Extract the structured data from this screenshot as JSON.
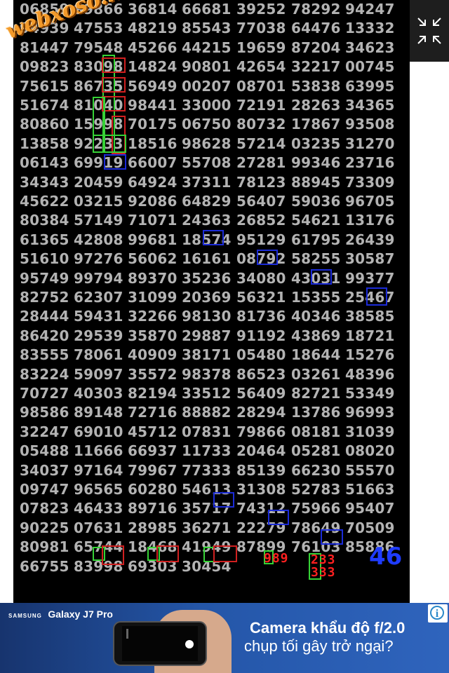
{
  "watermark": "webxoso.net",
  "rows": [
    [
      "06859",
      "99866",
      "36814",
      "66681",
      "39252",
      "78292",
      "94247"
    ],
    [
      "94939",
      "47553",
      "48219",
      "85543",
      "77038",
      "64476",
      "13332"
    ],
    [
      "81447",
      "79548",
      "45266",
      "44215",
      "19659",
      "87204",
      "34623"
    ],
    [
      "09823",
      "83098",
      "14824",
      "90801",
      "42654",
      "32217",
      "00745"
    ],
    [
      "75615",
      "86735",
      "56949",
      "00207",
      "08701",
      "53838",
      "63995"
    ],
    [
      "51674",
      "81040",
      "98441",
      "33000",
      "72191",
      "28263",
      "34365"
    ],
    [
      "80860",
      "15998",
      "70175",
      "06750",
      "80732",
      "17867",
      "93508"
    ],
    [
      "13858",
      "92233",
      "18516",
      "98628",
      "57214",
      "03235",
      "31270"
    ],
    [
      "06143",
      "69919",
      "66007",
      "55708",
      "27281",
      "99346",
      "23716"
    ],
    [
      "34343",
      "20459",
      "64924",
      "37311",
      "78123",
      "88945",
      "73309"
    ],
    [
      "45622",
      "03215",
      "92086",
      "64829",
      "56407",
      "59036",
      "96705"
    ],
    [
      "80384",
      "57149",
      "71071",
      "24363",
      "26852",
      "54621",
      "13176"
    ],
    [
      "61365",
      "42808",
      "99681",
      "18574",
      "95129",
      "61795",
      "26439"
    ],
    [
      "51610",
      "97276",
      "56062",
      "16161",
      "08792",
      "58255",
      "30587"
    ],
    [
      "95749",
      "99794",
      "89370",
      "35236",
      "34080",
      "43031",
      "99377"
    ],
    [
      "82752",
      "62307",
      "31099",
      "20369",
      "56321",
      "15355",
      "25467"
    ],
    [
      "28444",
      "59431",
      "32266",
      "98130",
      "81736",
      "40346",
      "38585"
    ],
    [
      "86420",
      "29539",
      "35870",
      "29887",
      "91192",
      "43869",
      "18721"
    ],
    [
      "83555",
      "78061",
      "40909",
      "38171",
      "05480",
      "18644",
      "15276"
    ],
    [
      "83224",
      "59097",
      "35572",
      "98378",
      "86523",
      "03261",
      "48396"
    ],
    [
      "70727",
      "40303",
      "82194",
      "33512",
      "56409",
      "82721",
      "53349"
    ],
    [
      "98586",
      "89148",
      "72716",
      "88882",
      "28294",
      "13786",
      "96993"
    ],
    [
      "32247",
      "69010",
      "45712",
      "07831",
      "79866",
      "08181",
      "31039"
    ],
    [
      "05488",
      "11666",
      "66937",
      "11733",
      "20464",
      "05281",
      "08020"
    ],
    [
      "34037",
      "97164",
      "79967",
      "77333",
      "85139",
      "66230",
      "55570"
    ],
    [
      "09747",
      "96565",
      "60280",
      "54613",
      "31308",
      "52783",
      "51663"
    ],
    [
      "07823",
      "46433",
      "89716",
      "35717",
      "74312",
      "75966",
      "95407"
    ],
    [
      "90225",
      "07631",
      "28985",
      "36271",
      "22279",
      "78649",
      "70509"
    ],
    [
      "80981",
      "65744",
      "18468",
      "41949",
      "87899",
      "76103",
      "85886"
    ],
    [
      "66755",
      "83998",
      "69303",
      "30454"
    ]
  ],
  "annotations": {
    "red_line1": "989",
    "red_line2a": "233",
    "red_line2b": "333",
    "big_number": "46"
  },
  "ad": {
    "brand": "SAMSUNG",
    "model": "Galaxy J7 Pro",
    "headline": "Camera khẩu độ f/2.0",
    "subline": "chụp tối gây trở ngại?",
    "info": "i"
  },
  "colors": {
    "board_bg": "#000000",
    "digits": "#b3b3b3",
    "highlight_green": "#36d236",
    "highlight_red": "#d02020",
    "highlight_blue": "#1b2bd8",
    "annotation_red": "#ff2020",
    "annotation_blue": "#1f3cff",
    "ad_bg": "#2456a8"
  },
  "icons": {
    "fullscreen": "exit-fullscreen-icon",
    "ad_info": "info-icon"
  }
}
